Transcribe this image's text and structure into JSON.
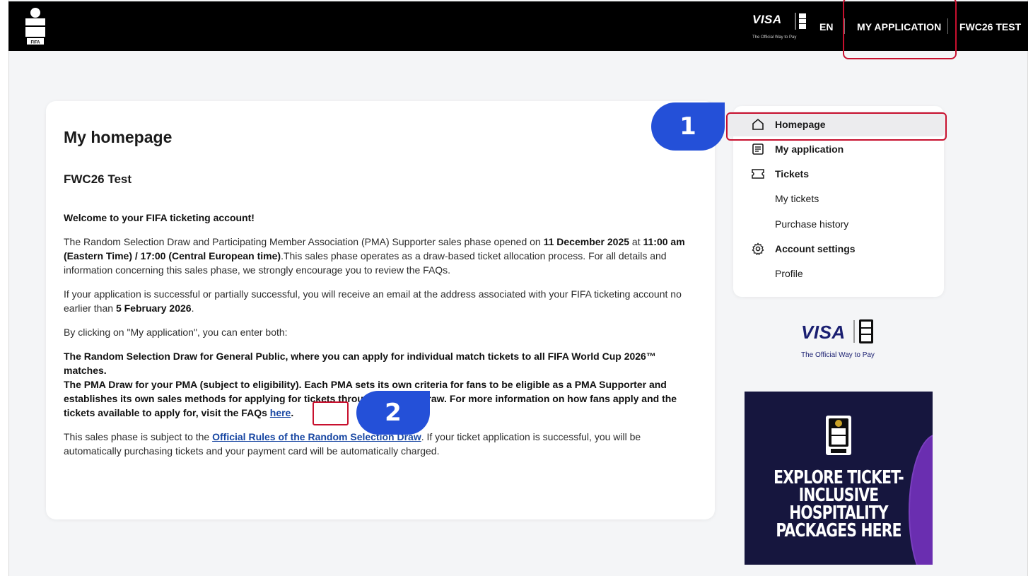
{
  "header": {
    "brand_logo": "fifa-2026-emblem",
    "sponsor": "VISA",
    "sponsor_tagline": "The Official Way to Pay",
    "language": "EN",
    "nav_my_application": "MY APPLICATION",
    "user_name": "FWC26 TEST"
  },
  "main": {
    "title": "My homepage",
    "subtitle": "FWC26 Test",
    "welcome": "Welcome to your FIFA ticketing account!",
    "p1_a": "The Random Selection Draw and Participating Member Association (PMA) Supporter sales phase opened on ",
    "p1_b": "11 December 2025",
    "p1_c": " at ",
    "p1_d": "11:00 am (Eastern Time) / 17:00 (Central European time)",
    "p1_e": ".This sales phase operates as a draw-based ticket allocation process. For all details and information concerning this sales phase, we strongly encourage you to review the FAQs.",
    "p2_a": "If your application is successful or partially successful, you will receive an email at the address associated with your FIFA ticketing account no earlier than ",
    "p2_b": "5 February 2026",
    "p2_c": ".",
    "p3": "By clicking on \"My application\", you can enter both:",
    "p4_line1": "The Random Selection Draw for General Public, where you can apply for individual match tickets to all FIFA World Cup 2026™ matches.",
    "p4_line2": "The PMA Draw for your PMA (subject to eligibility). Each PMA sets its own criteria for fans to be eligible as a PMA Supporter and establishes its own sales methods for applying for tickets through the PMA Draw. For more information on how fans apply and the tickets available to apply for, visit the FAQs ",
    "p4_link": "here",
    "p4_end": ".",
    "p5_a": "This sales phase is subject to the ",
    "p5_link": "Official Rules of the Random Selection Draw",
    "p5_b": ". If your ticket application is successful, you will be automatically purchasing tickets and your payment card will be automatically charged."
  },
  "sidebar": {
    "items": [
      {
        "label": "Homepage",
        "icon": "home-icon"
      },
      {
        "label": "My application",
        "icon": "document-icon"
      },
      {
        "label": "Tickets",
        "icon": "ticket-icon"
      },
      {
        "label": "My tickets"
      },
      {
        "label": "Purchase history"
      },
      {
        "label": "Account settings",
        "icon": "gear-icon"
      },
      {
        "label": "Profile"
      }
    ]
  },
  "promo": {
    "sponsor": "VISA",
    "sponsor_tagline": "The Official Way to Pay",
    "ad_text": "EXPLORE TICKET-INCLUSIVE HOSPITALITY PACKAGES HERE"
  },
  "annotations": {
    "badge_1": "1",
    "badge_2": "2",
    "highlight_color": "#c8102e",
    "badge_color": "#2450d8"
  }
}
